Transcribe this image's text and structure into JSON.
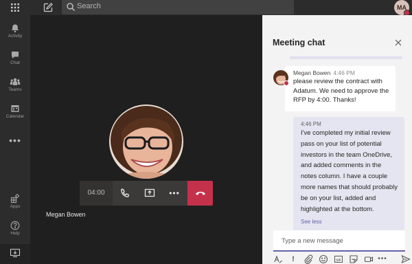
{
  "header": {
    "search_placeholder": "Search",
    "user_initials": "MA"
  },
  "rail": {
    "items": [
      {
        "label": "Activity",
        "icon": "bell-icon"
      },
      {
        "label": "Chat",
        "icon": "chat-icon"
      },
      {
        "label": "Teams",
        "icon": "teams-icon"
      },
      {
        "label": "Calendar",
        "icon": "calendar-icon"
      }
    ],
    "more_label": "•••",
    "bottom_items": [
      {
        "label": "Apps",
        "icon": "apps-icon"
      },
      {
        "label": "Help",
        "icon": "help-icon"
      }
    ]
  },
  "call": {
    "timer": "04:00",
    "participant_name": "Megan Bowen",
    "more_label": "•••"
  },
  "chat": {
    "title": "Meeting chat",
    "incoming": {
      "sender": "Megan Bowen",
      "time": "4:46 PM",
      "text": "please review the contract with Adatum. We need to approve the RFP by 4:00. Thanks!"
    },
    "outgoing": {
      "time": "4:46 PM",
      "text": "I've completed my initial review pass on your list of potential investors in the team OneDrive, and added comments in the notes column. I have a couple more names that should probably be on your list, added and highlighted at the bottom.",
      "see_less": "See less"
    },
    "compose_placeholder": "Type a new message",
    "toolbar": {
      "gif_label": "GIF",
      "more_label": "•••"
    }
  },
  "colors": {
    "accent": "#6264a7",
    "hangup": "#c4314b",
    "presence_busy": "#c4314b"
  }
}
